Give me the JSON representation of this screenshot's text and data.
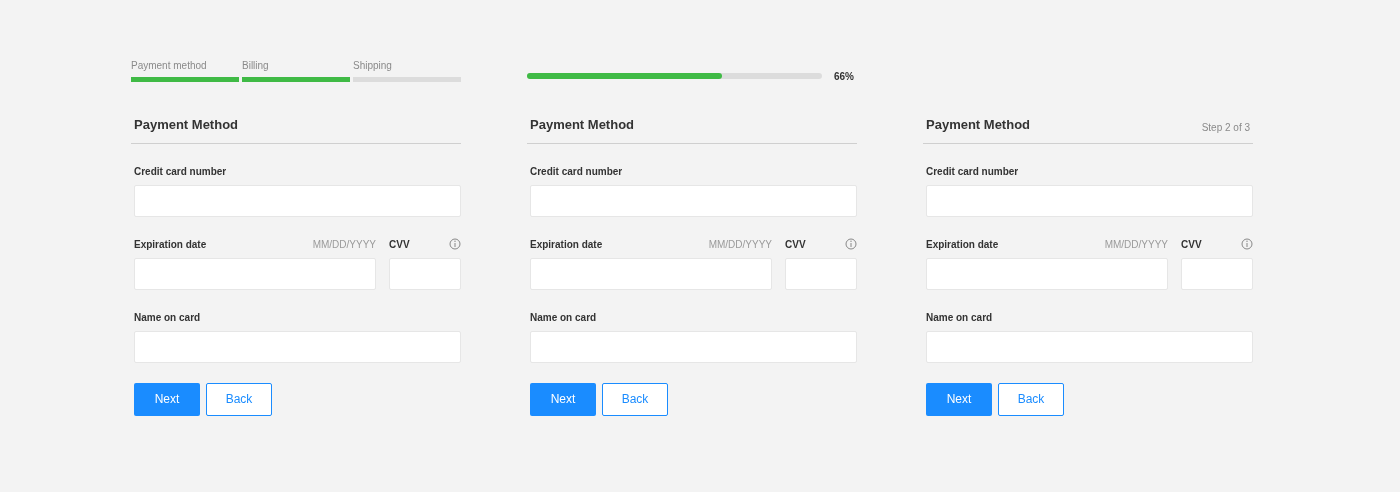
{
  "variants": [
    {
      "progress": {
        "kind": "steps",
        "steps": [
          {
            "label": "Payment method",
            "done": true
          },
          {
            "label": "Billing",
            "done": true
          },
          {
            "label": "Shipping",
            "done": false
          }
        ]
      },
      "title": "Payment Method",
      "card_label": "Credit card number",
      "expiry_label": "Expiration date",
      "expiry_hint": "MM/DD/YYYY",
      "cvv_label": "CVV",
      "name_label": "Name on card",
      "buttons": [
        "Next",
        "Back"
      ]
    },
    {
      "progress": {
        "kind": "bar",
        "level": 0.66,
        "reading": "66%"
      },
      "title": "Payment Method",
      "card_label": "Credit card number",
      "expiry_label": "Expiration date",
      "expiry_hint": "MM/DD/YYYY",
      "cvv_label": "CVV",
      "name_label": "Name on card",
      "buttons": [
        "Next",
        "Back"
      ]
    },
    {
      "progress": {
        "kind": "none"
      },
      "title": "Payment Method",
      "step_text": "Step 2 of 3",
      "card_label": "Credit card number",
      "expiry_label": "Expiration date",
      "expiry_hint": "MM/DD/YYYY",
      "cvv_label": "CVV",
      "name_label": "Name on card",
      "buttons": [
        "Next",
        "Back"
      ]
    }
  ]
}
